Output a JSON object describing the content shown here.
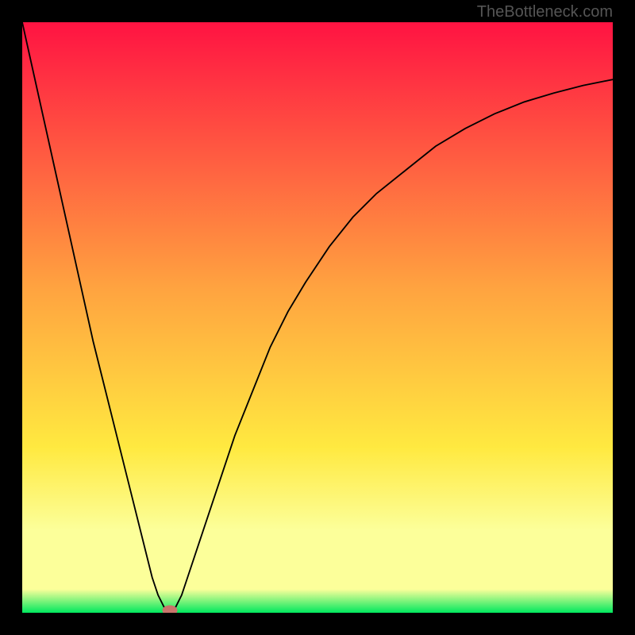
{
  "watermark": "TheBottleneck.com",
  "colors": {
    "frame": "#000000",
    "grad_top": "#FF1342",
    "grad_mid1": "#FFA340",
    "grad_mid2": "#FFE940",
    "grad_band": "#FCFF9A",
    "grad_bottom": "#00E85E",
    "curve": "#000000",
    "marker_fill": "#C9756B",
    "marker_stroke": "#C9756B"
  },
  "chart_data": {
    "type": "line",
    "title": "",
    "xlabel": "",
    "ylabel": "",
    "xlim": [
      0,
      100
    ],
    "ylim": [
      0,
      100
    ],
    "series": [
      {
        "name": "bottleneck-curve",
        "x": [
          0,
          2,
          4,
          6,
          8,
          10,
          12,
          14,
          16,
          18,
          20,
          22,
          23,
          24,
          25,
          26,
          27,
          28,
          30,
          32,
          34,
          36,
          38,
          40,
          42,
          45,
          48,
          52,
          56,
          60,
          65,
          70,
          75,
          80,
          85,
          90,
          95,
          100
        ],
        "y": [
          100,
          91,
          82,
          73,
          64,
          55,
          46,
          38,
          30,
          22,
          14,
          6,
          3,
          1,
          0.4,
          1,
          3,
          6,
          12,
          18,
          24,
          30,
          35,
          40,
          45,
          51,
          56,
          62,
          67,
          71,
          75,
          79,
          82,
          84.5,
          86.5,
          88,
          89.3,
          90.3
        ]
      }
    ],
    "marker": {
      "x": 25,
      "y": 0.4,
      "rx": 1.2,
      "ry": 0.8
    },
    "gradient_stops": [
      {
        "offset": 0,
        "color_key": "grad_top"
      },
      {
        "offset": 45,
        "color_key": "grad_mid1"
      },
      {
        "offset": 72,
        "color_key": "grad_mid2"
      },
      {
        "offset": 86,
        "color_key": "grad_band"
      },
      {
        "offset": 96,
        "color_key": "grad_band"
      },
      {
        "offset": 100,
        "color_key": "grad_bottom"
      }
    ]
  }
}
